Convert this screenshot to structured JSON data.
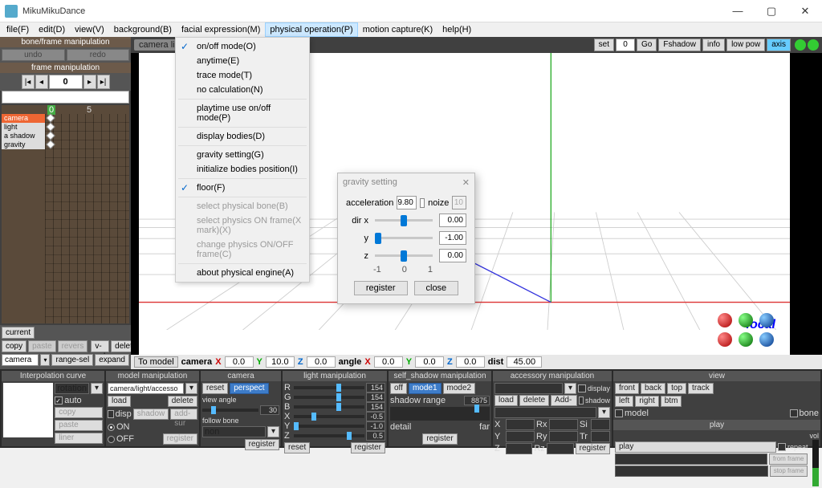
{
  "window": {
    "title": "MikuMikuDance"
  },
  "menubar": {
    "items": [
      "file(F)",
      "edit(D)",
      "view(V)",
      "background(B)",
      "facial expression(M)",
      "physical operation(P)",
      "motion capture(K)",
      "help(H)"
    ],
    "open_index": 5
  },
  "dropdown": {
    "items": [
      {
        "label": "on/off mode(O)",
        "checked": true
      },
      {
        "label": "anytime(E)"
      },
      {
        "label": "trace mode(T)"
      },
      {
        "label": "no calculation(N)"
      },
      {
        "sep": true
      },
      {
        "label": "playtime use on/off mode(P)"
      },
      {
        "sep": true
      },
      {
        "label": "display bodies(D)"
      },
      {
        "sep": true
      },
      {
        "label": "gravity setting(G)"
      },
      {
        "label": "initialize bodies position(I)"
      },
      {
        "sep": true
      },
      {
        "label": "floor(F)",
        "checked": true
      },
      {
        "sep": true
      },
      {
        "label": "select physical bone(B)",
        "disabled": true
      },
      {
        "label": "select physics ON frame(X mark)(X)",
        "disabled": true
      },
      {
        "label": "change physics ON/OFF frame(C)",
        "disabled": true
      },
      {
        "sep": true
      },
      {
        "label": "about physical engine(A)"
      }
    ]
  },
  "left": {
    "bone_panel": "bone/frame manipulation",
    "undo": "undo",
    "redo": "redo",
    "frame_panel": "frame manipulation",
    "frame_value": "0",
    "track_ruler": {
      "mark0": "0",
      "mark5": "5"
    },
    "tracks": [
      "camera",
      "light",
      "a shadow",
      "gravity"
    ],
    "current": "current",
    "copy": "copy",
    "paste": "paste",
    "revers": "revers",
    "vsel": "v-sel",
    "delete": "delete",
    "camera_label": "camera",
    "range_sel": "range-sel",
    "expand": "expand"
  },
  "viewport_header": {
    "title": "camera  lig",
    "set": "set",
    "set_val": "0",
    "go": "Go",
    "fshadow": "Fshadow",
    "info": "info",
    "lowpow": "low pow",
    "axis": "axis"
  },
  "viewport": {
    "axis_label": "local"
  },
  "gravity_dialog": {
    "title": "gravity setting",
    "acceleration_label": "acceleration",
    "acceleration": "9.80",
    "noize_label": "noize",
    "noize": "10",
    "dirx": "dir x",
    "y": "y",
    "z": "z",
    "vx": "0.00",
    "vy": "-1.00",
    "vz": "0.00",
    "scale": [
      "-1",
      "0",
      "1"
    ],
    "register": "register",
    "close": "close"
  },
  "coordbar": {
    "to_model": "To model",
    "camera": "camera",
    "angle": "angle",
    "dist": "dist",
    "x": "0.0",
    "y": "10.0",
    "z": "0.0",
    "ax": "0.0",
    "ay": "0.0",
    "az": "0.0",
    "dist_v": "45.00"
  },
  "bottom": {
    "interp": {
      "title": "Interpolation curve",
      "rotation": "rotation",
      "auto": "auto",
      "copy": "copy",
      "paste": "paste",
      "liner": "liner"
    },
    "model": {
      "title": "model manipulation",
      "combo": "camera/light/accesso",
      "load": "load",
      "delete": "delete",
      "disp": "disp",
      "shadow": "shadow",
      "addsur": "add-sur",
      "on": "ON",
      "off": "OFF",
      "register": "register"
    },
    "camera": {
      "title": "camera",
      "reset": "reset",
      "perspect": "perspect",
      "view_angle": "view angle",
      "va_val": "30",
      "follow": "follow bone",
      "follow_val": "non",
      "register": "register"
    },
    "light": {
      "title": "light manipulation",
      "r": "R",
      "g": "G",
      "b": "B",
      "x": "X",
      "y": "Y",
      "z": "Z",
      "vr": "154",
      "vg": "154",
      "vb": "154",
      "vx": "-0.5",
      "vy": "-1.0",
      "vz": "0.5",
      "reset": "reset",
      "register": "register"
    },
    "shadow": {
      "title": "self_shadow manipulation",
      "off": "off",
      "mode1": "mode1",
      "mode2": "mode2",
      "range": "shadow range",
      "range_v": "8875",
      "detail": "detail",
      "far": "far",
      "register": "register"
    },
    "acc": {
      "title": "accessory manipulation",
      "load": "load",
      "delete": "delete",
      "addsum": "Add-sum",
      "x": "X",
      "y": "Y",
      "z": "Z",
      "rx": "Rx",
      "ry": "Ry",
      "rz": "Rz",
      "si": "Si",
      "tr": "Tr",
      "register": "register",
      "display": "display",
      "shadow": "shadow"
    },
    "view": {
      "title": "view",
      "front": "front",
      "back": "back",
      "top": "top",
      "track": "track",
      "left": "left",
      "right": "right",
      "btm": "btm",
      "model": "model",
      "bone": "bone",
      "play_h": "play",
      "play": "play",
      "repeat": "repeat",
      "from": "from frame",
      "stop": "stop frame",
      "vol": "vol"
    }
  }
}
